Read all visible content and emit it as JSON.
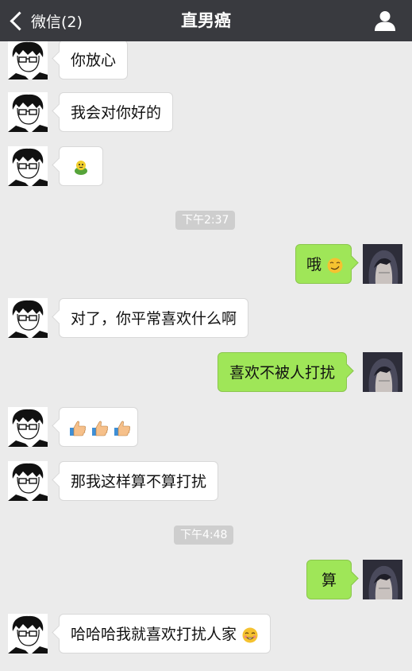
{
  "navbar": {
    "back_label": "微信(2)",
    "title": "直男癌",
    "back_icon": "chevron-left-icon",
    "user_icon": "person-icon"
  },
  "messages": [
    {
      "side": "left",
      "text": "你放心"
    },
    {
      "side": "left",
      "text": "我会对你好的"
    },
    {
      "side": "left",
      "emoji": "bug-emoji"
    },
    {
      "type": "time",
      "text": "下午2:37"
    },
    {
      "side": "right",
      "text": "哦",
      "emoji": "smirk-emoji"
    },
    {
      "side": "left",
      "text": "对了，你平常喜欢什么啊"
    },
    {
      "side": "right",
      "text": "喜欢不被人打扰"
    },
    {
      "side": "left",
      "emoji": "thumbs-up-emoji x3"
    },
    {
      "side": "left",
      "text": "那我这样算不算打扰"
    },
    {
      "type": "time",
      "text": "下午4:48"
    },
    {
      "side": "right",
      "text": "算"
    },
    {
      "side": "left",
      "text": "哈哈哈我就喜欢打扰人家",
      "emoji": "blush-emoji"
    }
  ],
  "colors": {
    "navbar_bg": "#393a3f",
    "chat_bg": "#ebebeb",
    "bubble_sent": "#9fe658",
    "bubble_received": "#ffffff",
    "time_badge_bg": "#cecece"
  }
}
